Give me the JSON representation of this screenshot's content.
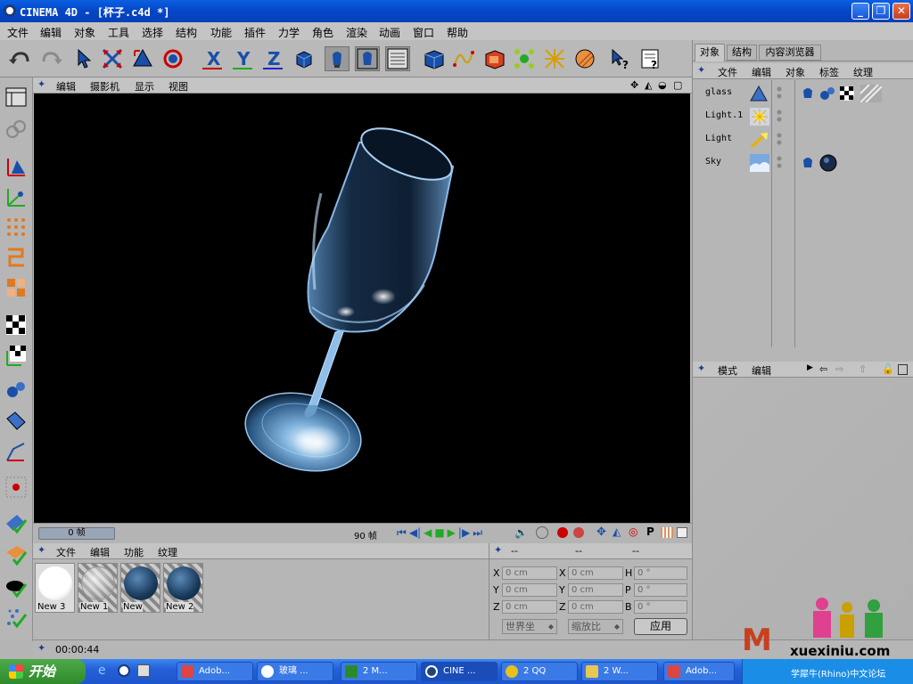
{
  "window": {
    "title": "CINEMA 4D - [杯子.c4d *]"
  },
  "menubar": [
    "文件",
    "编辑",
    "对象",
    "工具",
    "选择",
    "结构",
    "功能",
    "插件",
    "力学",
    "角色",
    "渲染",
    "动画",
    "窗口",
    "帮助"
  ],
  "viewport": {
    "menu": [
      "编辑",
      "摄影机",
      "显示",
      "视图"
    ]
  },
  "timeline": {
    "current_frame": "0 帧",
    "end_frame": "90 帧"
  },
  "material_manager": {
    "menu": [
      "文件",
      "编辑",
      "功能",
      "纹理"
    ],
    "materials": [
      {
        "name": "New 3",
        "style": "white"
      },
      {
        "name": "New 1",
        "style": "glass"
      },
      {
        "name": "New",
        "style": "blue"
      },
      {
        "name": "New 2",
        "style": "blue"
      }
    ]
  },
  "coordinates": {
    "header": [
      "--",
      "--",
      "--"
    ],
    "rows": [
      {
        "a": "X",
        "a_val": "0 cm",
        "b": "X",
        "b_val": "0 cm",
        "c": "H",
        "c_val": "0 °"
      },
      {
        "a": "Y",
        "a_val": "0 cm",
        "b": "Y",
        "b_val": "0 cm",
        "c": "P",
        "c_val": "0 °"
      },
      {
        "a": "Z",
        "a_val": "0 cm",
        "b": "Z",
        "b_val": "0 cm",
        "c": "B",
        "c_val": "0 °"
      }
    ],
    "coord_system": "世界坐",
    "scale_mode": "缩放比",
    "apply_label": "应用"
  },
  "object_manager": {
    "tabs": [
      "对象",
      "结构",
      "内容浏览器"
    ],
    "menu": [
      "文件",
      "编辑",
      "对象",
      "标签",
      "纹理"
    ],
    "objects": [
      {
        "name": "glass",
        "icon": "cone-icon",
        "tags": [
          "material-tag-icon",
          "phong-tag-icon",
          "checker-tag-icon",
          "stripe-tag-icon"
        ]
      },
      {
        "name": "Light.1",
        "icon": "light-icon",
        "tags": []
      },
      {
        "name": "Light",
        "icon": "spot-light-icon",
        "tags": []
      },
      {
        "name": "Sky",
        "icon": "sky-icon",
        "tags": [
          "material-tag-icon",
          "sphere-tag-icon"
        ]
      }
    ]
  },
  "attribute_manager": {
    "menu": [
      "模式",
      "编辑"
    ]
  },
  "status": {
    "time": "00:00:44"
  },
  "taskbar": {
    "start": "开始",
    "tasks": [
      {
        "label": "Adob...",
        "color": "#d44"
      },
      {
        "label": "玻璃 ...",
        "color": "#2a5"
      },
      {
        "label": "2 M...",
        "color": "#2a8a2a"
      },
      {
        "label": "CINE ...",
        "color": "#247"
      },
      {
        "label": "2 QQ",
        "color": "#e8c020"
      },
      {
        "label": "2 W...",
        "color": "#e8c850"
      },
      {
        "label": "Adob...",
        "color": "#d44"
      }
    ]
  },
  "watermark": {
    "site": "xuexiniu.com",
    "caption": "学犀牛(Rhino)中文论坛"
  },
  "colors": {
    "titlebar": "#0546c8",
    "viewport_bg": "#000000",
    "icon_blue": "#1a4fa8"
  }
}
